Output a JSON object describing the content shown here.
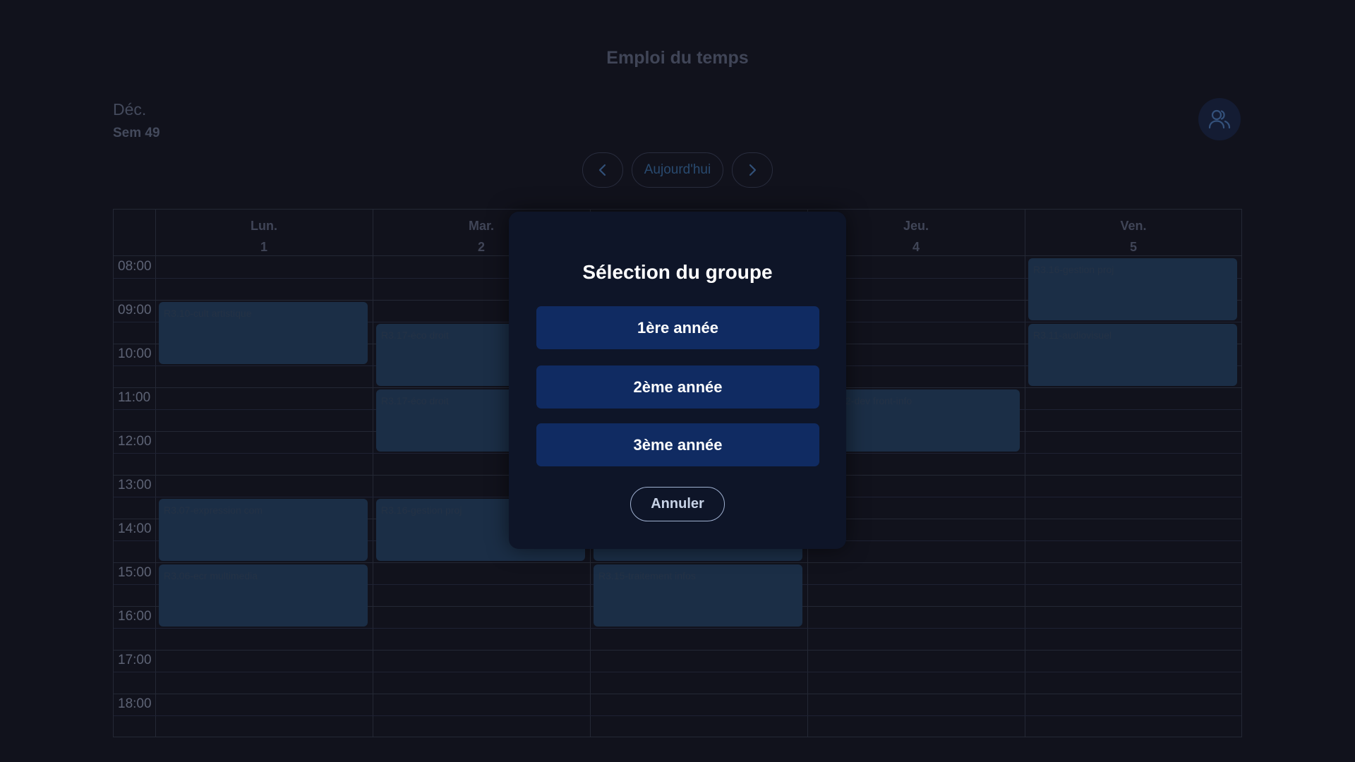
{
  "header": {
    "title": "Emploi du temps",
    "month": "Déc.",
    "week": "Sem 49"
  },
  "nav": {
    "today_label": "Aujourd'hui",
    "prev_icon": "chevron-left-icon",
    "next_icon": "chevron-right-icon"
  },
  "group_button": {
    "icon": "users-icon"
  },
  "days": [
    {
      "name": "Lun.",
      "num": "1"
    },
    {
      "name": "Mar.",
      "num": "2"
    },
    {
      "name": "",
      "num": ""
    },
    {
      "name": "Jeu.",
      "num": "4"
    },
    {
      "name": "Ven.",
      "num": "5"
    }
  ],
  "hours": [
    "08:00",
    "09:00",
    "10:00",
    "11:00",
    "12:00",
    "13:00",
    "14:00",
    "15:00",
    "16:00",
    "17:00",
    "18:00"
  ],
  "events": [
    {
      "day": 0,
      "start": "09:00",
      "end": "10:30",
      "label": "R3.10-cult artistique"
    },
    {
      "day": 0,
      "start": "13:30",
      "end": "15:00",
      "label": "R3.07-expression com"
    },
    {
      "day": 0,
      "start": "15:00",
      "end": "16:30",
      "label": "R3.06-ecr multimedia"
    },
    {
      "day": 1,
      "start": "09:30",
      "end": "11:00",
      "label": "R3.17-éco droit"
    },
    {
      "day": 1,
      "start": "11:00",
      "end": "12:30",
      "label": "R3.17-éco droit"
    },
    {
      "day": 1,
      "start": "13:30",
      "end": "15:00",
      "label": "R3.16-gestion proj"
    },
    {
      "day": 2,
      "start": "14:30",
      "end": "15:00",
      "label": ""
    },
    {
      "day": 2,
      "start": "15:00",
      "end": "16:30",
      "label": "R3.15-traitement infos"
    },
    {
      "day": 3,
      "start": "11:00",
      "end": "12:30",
      "label": "3-R3.12-dev front-info"
    },
    {
      "day": 4,
      "start": "08:00",
      "end": "09:30",
      "label": "R3.16-gestion proj"
    },
    {
      "day": 4,
      "start": "09:30",
      "end": "11:00",
      "label": "R3.11-audiovisuel"
    }
  ],
  "modal": {
    "title": "Sélection du groupe",
    "options": [
      "1ère année",
      "2ème année",
      "3ème année"
    ],
    "cancel_label": "Annuler"
  }
}
